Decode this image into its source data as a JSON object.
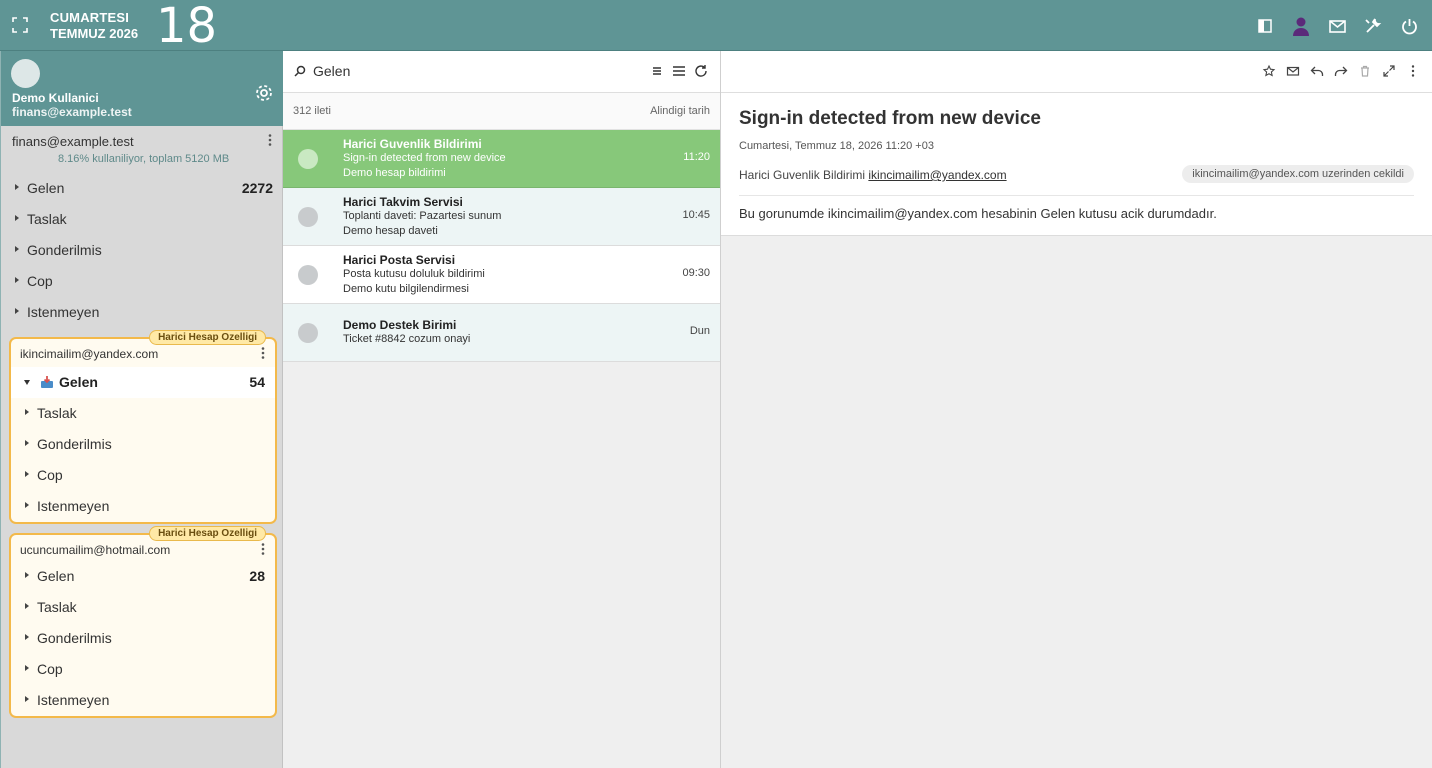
{
  "topbar": {
    "day_name": "CUMARTESI",
    "month_year": "TEMMUZ 2026",
    "day_number": "18"
  },
  "profile": {
    "name": "Demo Kullanici",
    "email": "finans@example.test"
  },
  "main_account": {
    "email": "finans@example.test",
    "usage": "8.16% kullaniliyor, toplam 5120 MB",
    "folders": [
      {
        "name": "Gelen",
        "count": "2272"
      },
      {
        "name": "Taslak",
        "count": ""
      },
      {
        "name": "Gonderilmis",
        "count": ""
      },
      {
        "name": "Cop",
        "count": ""
      },
      {
        "name": "Istenmeyen",
        "count": ""
      }
    ]
  },
  "external_accounts": [
    {
      "badge": "Harici Hesap Ozelligi",
      "email": "ikincimailim@yandex.com",
      "folders": [
        {
          "name": "Gelen",
          "count": "54"
        },
        {
          "name": "Taslak",
          "count": ""
        },
        {
          "name": "Gonderilmis",
          "count": ""
        },
        {
          "name": "Cop",
          "count": ""
        },
        {
          "name": "Istenmeyen",
          "count": ""
        }
      ]
    },
    {
      "badge": "Harici Hesap Ozelligi",
      "email": "ucuncumailim@hotmail.com",
      "folders": [
        {
          "name": "Gelen",
          "count": "28"
        },
        {
          "name": "Taslak",
          "count": ""
        },
        {
          "name": "Gonderilmis",
          "count": ""
        },
        {
          "name": "Cop",
          "count": ""
        },
        {
          "name": "Istenmeyen",
          "count": ""
        }
      ]
    }
  ],
  "list": {
    "search_text": "Gelen",
    "count": "312 ileti",
    "sort": "Alindigi tarih",
    "messages": [
      {
        "from": "Harici Guvenlik Bildirimi",
        "subject": "Sign-in detected from new device",
        "preview": "Demo hesap bildirimi",
        "time": "11:20"
      },
      {
        "from": "Harici Takvim Servisi",
        "subject": "Toplanti daveti: Pazartesi sunum",
        "preview": "Demo hesap daveti",
        "time": "10:45"
      },
      {
        "from": "Harici Posta Servisi",
        "subject": "Posta kutusu doluluk bildirimi",
        "preview": "Demo kutu bilgilendirmesi",
        "time": "09:30"
      },
      {
        "from": "Demo Destek Birimi",
        "subject": "Ticket #8842 cozum onayi",
        "preview": "",
        "time": "Dun"
      }
    ]
  },
  "reader": {
    "subject": "Sign-in detected from new device",
    "date": "Cumartesi, Temmuz 18, 2026 11:20 +03",
    "from_name": "Harici Guvenlik Bildirimi",
    "from_email": "ikincimailim@yandex.com",
    "chip": "ikincimailim@yandex.com uzerinden cekildi",
    "body": "Bu gorunumde ikincimailim@yandex.com hesabinin Gelen kutusu acik durumdadır."
  },
  "colors": {
    "header": "#5f9595",
    "selected_row": "#87c87a",
    "external_border": "#f3b94a"
  }
}
